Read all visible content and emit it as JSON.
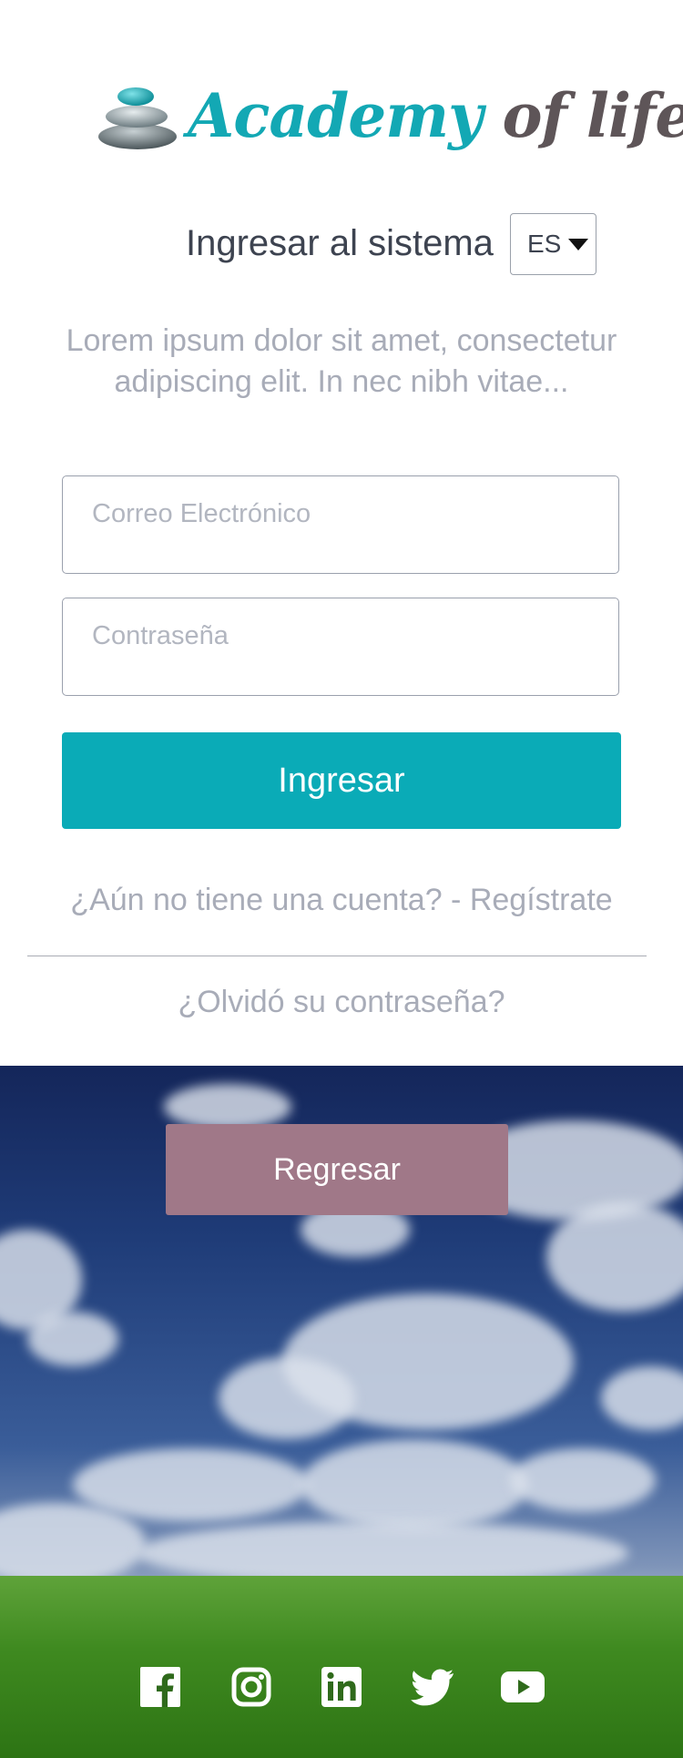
{
  "logo": {
    "word1": "Academy",
    "word2": "of life"
  },
  "header": {
    "title": "Ingresar al sistema",
    "language": "ES"
  },
  "intro": "Lorem ipsum dolor sit amet, consectetur adipiscing elit. In nec nibh vitae...",
  "form": {
    "email_placeholder": "Correo Electrónico",
    "password_placeholder": "Contraseña",
    "submit_label": "Ingresar"
  },
  "links": {
    "register": "¿Aún no tiene una cuenta? - Regístrate",
    "forgot": "¿Olvidó su contraseña?"
  },
  "back_label": "Regresar",
  "social": [
    "facebook-icon",
    "instagram-icon",
    "linkedin-icon",
    "twitter-icon",
    "youtube-icon"
  ],
  "colors": {
    "brand_teal": "#0aabb7",
    "brand_gray": "#5e5558",
    "back_button": "#a07888"
  }
}
